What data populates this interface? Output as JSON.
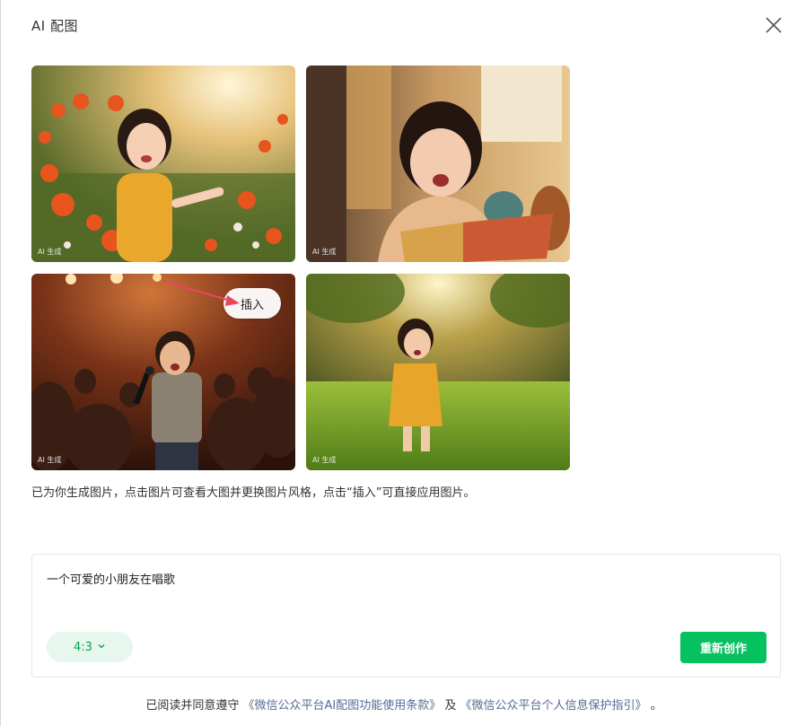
{
  "dialog": {
    "title": "AI 配图"
  },
  "images": [
    {
      "caption": "AI 生成",
      "description": "girl-in-flower-field"
    },
    {
      "caption": "AI 生成",
      "description": "girl-reading-book"
    },
    {
      "caption": "AI 生成",
      "description": "boy-singing-on-stage",
      "insert_label": "插入"
    },
    {
      "caption": "AI 生成",
      "description": "toddler-on-grass"
    }
  ],
  "hint": "已为你生成图片，点击图片可查看大图并更换图片风格，点击“插入”可直接应用图片。",
  "prompt": {
    "text": "一个可爱的小朋友在唱歌",
    "ratio": "4:3",
    "regenerate_label": "重新创作"
  },
  "footer": {
    "prefix": "已阅读并同意遵守",
    "terms_link": "《微信公众平台AI配图功能使用条款》",
    "joiner": "及",
    "privacy_link": "《微信公众平台个人信息保护指引》",
    "suffix": "。"
  },
  "colors": {
    "accent": "#07c160",
    "link": "#576b95",
    "ratio_bg": "#e7f7ed",
    "annotation_arrow": "#e8475f"
  },
  "icons": {
    "close": "close-icon",
    "ratio_dropdown": "chevron-down-icon"
  }
}
